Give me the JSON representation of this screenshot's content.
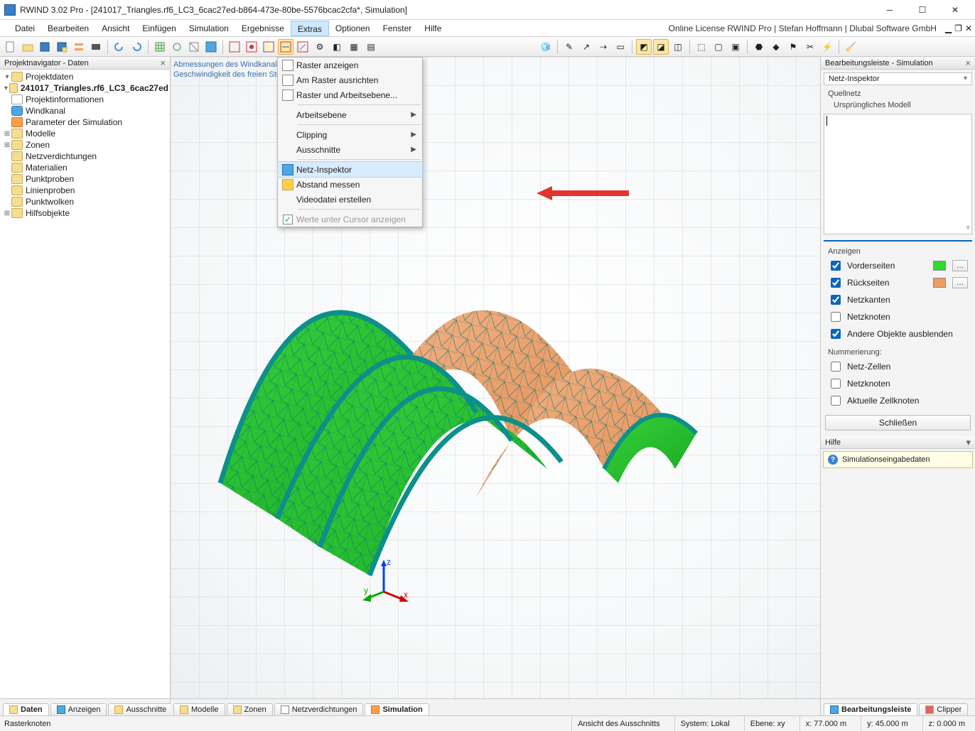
{
  "title": "RWIND 3.02 Pro - [241017_Triangles.rf6_LC3_6cac27ed-b864-473e-80be-5576bcac2cfa*, Simulation]",
  "license": "Online License RWIND Pro | Stefan Hoffmann | Dlubal Software GmbH",
  "menus": [
    "Datei",
    "Bearbeiten",
    "Ansicht",
    "Einfügen",
    "Simulation",
    "Ergebnisse",
    "Extras",
    "Optionen",
    "Fenster",
    "Hilfe"
  ],
  "dropdown": {
    "items": [
      {
        "label": "Raster anzeigen",
        "icon": "grid"
      },
      {
        "label": "Am Raster ausrichten",
        "icon": "snap"
      },
      {
        "label": "Raster und Arbeitsebene...",
        "icon": "raster"
      },
      {
        "sep": true
      },
      {
        "label": "Arbeitsebene",
        "submenu": true
      },
      {
        "sep": true
      },
      {
        "label": "Clipping",
        "submenu": true
      },
      {
        "label": "Ausschnitte",
        "submenu": true
      },
      {
        "sep": true
      },
      {
        "label": "Netz-Inspektor",
        "icon": "mesh",
        "hl": true
      },
      {
        "label": "Abstand messen",
        "icon": "measure"
      },
      {
        "label": "Videodatei erstellen"
      },
      {
        "sep": true
      },
      {
        "label": "Werte unter Cursor anzeigen",
        "icon": "check",
        "disabled": true
      }
    ]
  },
  "hint_lines": [
    "Abmessungen des Windkanals:",
    "Geschwindigkeit des freien Str"
  ],
  "nav": {
    "title": "Projektnavigator - Daten",
    "root": "Projektdaten",
    "project": "241017_Triangles.rf6_LC3_6cac27ed",
    "children": [
      {
        "label": "Projektinformationen",
        "icon": "doc"
      },
      {
        "label": "Windkanal",
        "icon": "cyl"
      },
      {
        "label": "Parameter der Simulation",
        "icon": "slid"
      },
      {
        "label": "Modelle",
        "expander": "+"
      },
      {
        "label": "Zonen",
        "expander": "+"
      },
      {
        "label": "Netzverdichtungen"
      },
      {
        "label": "Materialien"
      },
      {
        "label": "Punktproben"
      },
      {
        "label": "Linienproben"
      },
      {
        "label": "Punktwolken"
      },
      {
        "label": "Hilfsobjekte",
        "expander": "+"
      }
    ]
  },
  "left_tabs": [
    "Daten",
    "Anzeigen",
    "Ausschnitte"
  ],
  "center_tabs": [
    "Modelle",
    "Zonen",
    "Netzverdichtungen",
    "Simulation"
  ],
  "right_tabs": [
    "Bearbeitungsleiste",
    "Clipper"
  ],
  "right": {
    "title": "Bearbeitungsleiste - Simulation",
    "dropdown": "Netz-Inspektor",
    "quellnetz": "Quellnetz",
    "ursp": "Ursprüngliches Modell",
    "anzeigen": "Anzeigen",
    "checks": [
      {
        "label": "Vorderseiten",
        "checked": true,
        "color": "#2bdc2b"
      },
      {
        "label": "Rückseiten",
        "checked": true,
        "color": "#ef9e62"
      },
      {
        "label": "Netzkanten",
        "checked": true
      },
      {
        "label": "Netzknoten",
        "checked": false
      },
      {
        "label": "Andere Objekte ausblenden",
        "checked": true
      }
    ],
    "numm": "Nummerierung:",
    "numchecks": [
      {
        "label": "Netz-Zellen"
      },
      {
        "label": "Netzknoten"
      },
      {
        "label": "Aktuelle Zellknoten"
      }
    ],
    "close": "Schließen",
    "help_title": "Hilfe",
    "help_body": "Simulationseingabedaten"
  },
  "status": {
    "left": "Rasterknoten",
    "view": "Ansicht des Ausschnitts",
    "system": "System: Lokal",
    "plane": "Ebene: xy",
    "x": "x: 77.000 m",
    "y": "y: 45.000 m",
    "z": "z: 0.000 m"
  },
  "triad": {
    "x": "x",
    "y": "y",
    "z": "z"
  }
}
